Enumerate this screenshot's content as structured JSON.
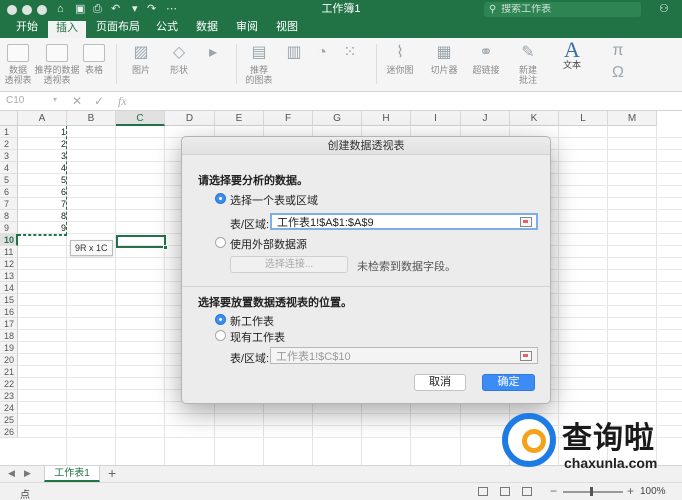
{
  "window": {
    "title": "工作簿1",
    "search_placeholder": "搜索工作表"
  },
  "tabs": [
    "开始",
    "插入",
    "页面布局",
    "公式",
    "数据",
    "审阅",
    "视图"
  ],
  "active_tab": "插入",
  "ribbon": {
    "pivot_table": "数据\n透视表",
    "recommended_pivot": "推荐的数据\n透视表",
    "table": "表格",
    "pictures": "图片",
    "shapes": "形状",
    "recommended_charts": "推荐\n的图表",
    "sparklines": "迷你图",
    "slicer": "切片器",
    "hyperlink": "超链接",
    "comment": "新建\n批注",
    "text": "文本"
  },
  "formula_bar": {
    "name_box": "C10",
    "fx": "fx"
  },
  "grid": {
    "columns": [
      "A",
      "B",
      "C",
      "D",
      "E",
      "F",
      "G",
      "H",
      "I",
      "J",
      "K",
      "L",
      "M"
    ],
    "rows": [
      "1",
      "2",
      "3",
      "4",
      "5",
      "6",
      "7",
      "8",
      "9",
      "10",
      "11",
      "12",
      "13",
      "14",
      "15",
      "16",
      "17",
      "18",
      "19",
      "20",
      "21",
      "22",
      "23",
      "24",
      "25",
      "26"
    ],
    "selected_column": "C",
    "selected_row": "10",
    "column_a_values": [
      "1",
      "2",
      "3",
      "4",
      "5",
      "6",
      "7",
      "8",
      "9"
    ],
    "selection_tooltip": "9R x 1C"
  },
  "sheet_tabs": {
    "active": "工作表1"
  },
  "status_bar": {
    "status": "点",
    "zoom": "100%"
  },
  "dialog": {
    "title": "创建数据透视表",
    "section1_heading": "请选择要分析的数据。",
    "option_table_range": "选择一个表或区域",
    "range_label": "表/区域:",
    "range_value": "工作表1!$A$1:$A$9",
    "option_external": "使用外部数据源",
    "choose_connection": "选择连接...",
    "no_fields_hint": "未检索到数据字段。",
    "section2_heading": "选择要放置数据透视表的位置。",
    "option_new_sheet": "新工作表",
    "option_existing_sheet": "现有工作表",
    "location_label": "表/区域:",
    "location_value": "工作表1!$C$10",
    "cancel": "取消",
    "ok": "确定"
  },
  "watermark": {
    "name": "查询啦",
    "url": "chaxunla.com"
  },
  "colors": {
    "excel_green": "#217346",
    "accent_blue": "#3d8cf5"
  }
}
